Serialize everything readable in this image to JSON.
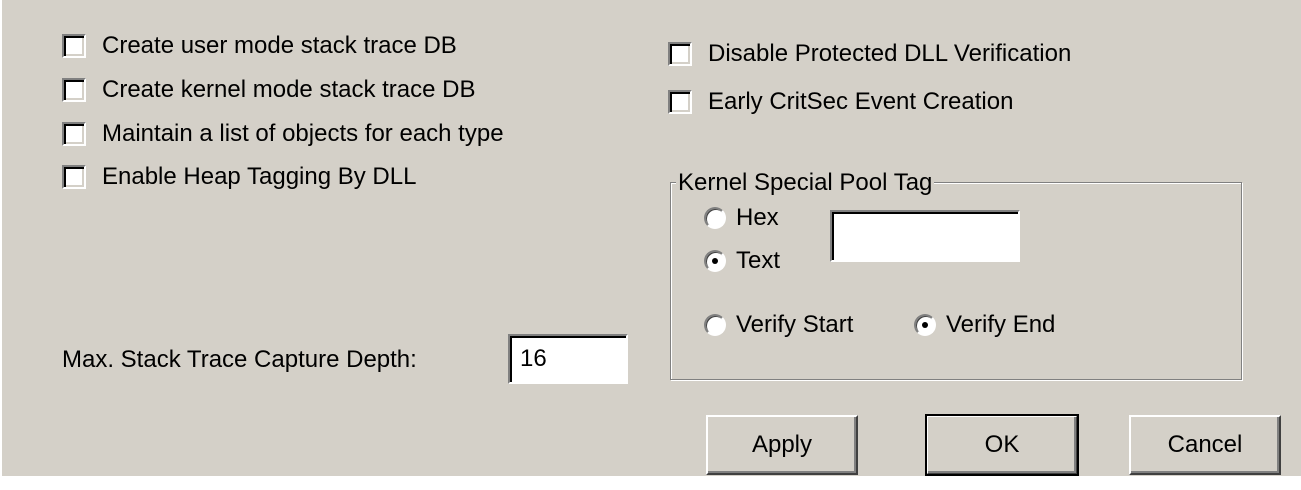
{
  "window": {
    "background": "#d4d0c8"
  },
  "left_checkboxes": [
    {
      "label": "Create user mode stack trace DB",
      "checked": false
    },
    {
      "label": "Create kernel mode stack trace DB",
      "checked": false
    },
    {
      "label": "Maintain a list of objects for each type",
      "checked": false
    },
    {
      "label": "Enable Heap Tagging By DLL",
      "checked": false
    }
  ],
  "right_checkboxes": [
    {
      "label": "Disable Protected DLL Verification",
      "checked": false
    },
    {
      "label": "Early CritSec Event Creation",
      "checked": false
    }
  ],
  "kernel_pool": {
    "title": "Kernel Special Pool Tag",
    "hex_label": "Hex",
    "text_label": "Text",
    "tag_value": "",
    "verify_start_label": "Verify Start",
    "verify_end_label": "Verify End",
    "selected_format": "Text",
    "selected_verify": "Verify End"
  },
  "stack_trace": {
    "label": "Max. Stack Trace Capture Depth:",
    "value": "16"
  },
  "buttons": {
    "apply": "Apply",
    "ok": "OK",
    "cancel": "Cancel"
  }
}
